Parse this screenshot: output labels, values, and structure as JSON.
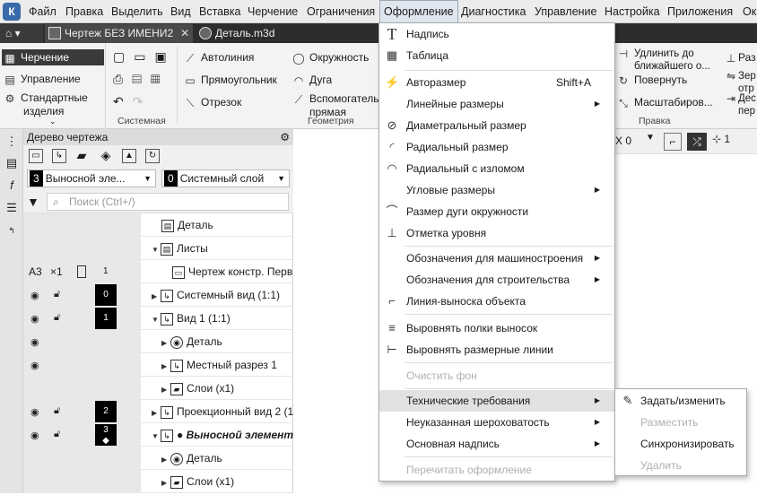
{
  "menubar": {
    "items": [
      {
        "label": "Файл"
      },
      {
        "label": "Правка"
      },
      {
        "label": "Выделить"
      },
      {
        "label": "Вид"
      },
      {
        "label": "Вставка"
      },
      {
        "label": "Черчение"
      },
      {
        "label": "Ограничения"
      },
      {
        "label": "Оформление"
      },
      {
        "label": "Диагностика"
      },
      {
        "label": "Управление"
      },
      {
        "label": "Настройка"
      },
      {
        "label": "Приложения"
      },
      {
        "label": "Ок"
      }
    ]
  },
  "tabs": [
    {
      "label": "Чертеж БЕЗ ИМЕНИ2",
      "close": "✕"
    },
    {
      "label": "Деталь.m3d"
    }
  ],
  "ribbon": {
    "left": [
      {
        "label": "Черчение"
      },
      {
        "label": "Управление"
      },
      {
        "label": "Стандартные"
      },
      {
        "label": "изделия"
      }
    ],
    "system_label": "Системная",
    "geometry_items": [
      {
        "label": "Автолиния"
      },
      {
        "label": "Прямоугольник"
      },
      {
        "label": "Отрезок"
      },
      {
        "label": "Окружность"
      },
      {
        "label": "Дуга"
      },
      {
        "label": "Вспомогательная"
      },
      {
        "label": "прямая"
      }
    ],
    "geometry_label": "Геометрия",
    "edit_items": [
      {
        "label": "Удлинить до"
      },
      {
        "label": "ближайшего о..."
      },
      {
        "label": "Повернуть"
      },
      {
        "label": "Масштабиров..."
      },
      {
        "label": "Раз"
      },
      {
        "label": "Зер"
      },
      {
        "label": "отр"
      },
      {
        "label": "Дес"
      },
      {
        "label": "пер"
      }
    ],
    "edit_label": "Правка"
  },
  "tree": {
    "title": "Дерево чертежа",
    "combo_layer_num": "3",
    "combo_layer_label": "Выносной эле...",
    "combo_sys_num": "0",
    "combo_sys_label": "Системный слой",
    "search_placeholder": "Поиск (Ctrl+/)",
    "sheet_row": {
      "format": "A3",
      "scale": "×1",
      "num": "1"
    },
    "rows": [
      {
        "label": "Деталь"
      },
      {
        "label": "Листы"
      },
      {
        "label": "Чертеж констр. Перв"
      },
      {
        "label": "Системный вид (1:1)",
        "layer": "0"
      },
      {
        "label": "Вид 1 (1:1)",
        "layer": "1"
      },
      {
        "label": "Деталь"
      },
      {
        "label": "Местный разрез 1"
      },
      {
        "label": "Слои (x1)"
      },
      {
        "label": "Проекционный вид 2 (1",
        "layer": "2"
      },
      {
        "label": "Выносной элемент",
        "layer": "3"
      },
      {
        "label": "Деталь"
      },
      {
        "label": "Слои (x1)"
      }
    ]
  },
  "canvas_tools": {
    "xval": "0",
    "one": "1"
  },
  "dropdown": {
    "items": [
      {
        "label": "Надпись",
        "icon": "T"
      },
      {
        "label": "Таблица"
      },
      {
        "label": "Авторазмер",
        "shortcut": "Shift+A"
      },
      {
        "label": "Линейные размеры"
      },
      {
        "label": "Диаметральный размер"
      },
      {
        "label": "Радиальный размер"
      },
      {
        "label": "Радиальный с изломом"
      },
      {
        "label": "Угловые размеры"
      },
      {
        "label": "Размер дуги окружности"
      },
      {
        "label": "Отметка уровня"
      },
      {
        "label": "Обозначения для машиностроения"
      },
      {
        "label": "Обозначения для строительства"
      },
      {
        "label": "Линия-выноска объекта"
      },
      {
        "label": "Выровнять полки выносок"
      },
      {
        "label": "Выровнять размерные линии"
      },
      {
        "label": "Очистить фон"
      },
      {
        "label": "Технические требования"
      },
      {
        "label": "Неуказанная шероховатость"
      },
      {
        "label": "Основная надпись"
      },
      {
        "label": "Перечитать оформление"
      }
    ]
  },
  "submenu": {
    "items": [
      {
        "label": "Задать/изменить"
      },
      {
        "label": "Разместить"
      },
      {
        "label": "Синхронизировать"
      },
      {
        "label": "Удалить"
      }
    ]
  }
}
